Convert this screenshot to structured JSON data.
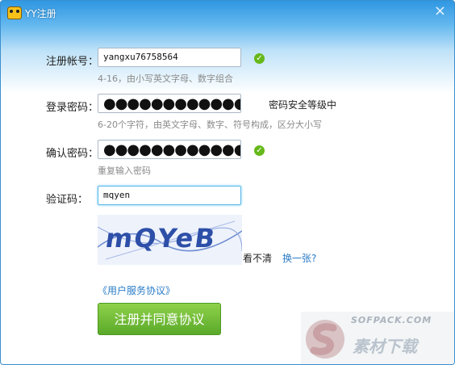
{
  "window": {
    "title": "YY注册",
    "close_label": "×"
  },
  "form": {
    "account": {
      "label": "注册帐号：",
      "value": "yangxu76758564",
      "hint": "4-16，由小写英文字母、数字组合"
    },
    "password": {
      "label": "登录密码：",
      "value": "●●●●●●●●●●●●●",
      "hint": "6-20个字符，由英文字母、数字、符号构成，区分大小写",
      "strength": "密码安全等级中"
    },
    "confirm": {
      "label": "确认密码：",
      "value": "●●●●●●●●●●●●●",
      "hint": "重复输入密码"
    },
    "captcha": {
      "label": "验证码：",
      "value": "mqyen",
      "image_text": "mQYeB",
      "cant_see": "看不清",
      "change_link": "换一张?"
    },
    "agreement_link": "《用户服务协议》",
    "submit_label": "注册并同意协议"
  },
  "watermark": {
    "top": "SOFPACK.COM",
    "main": "素材下载"
  },
  "colors": {
    "accent": "#2a7cc7",
    "submit": "#6fbf33",
    "check": "#66b81b",
    "titlebar": "#2f97e2"
  },
  "icons": {
    "app": "yy-bear-icon",
    "valid": "check-circle-icon",
    "close": "close-icon"
  }
}
